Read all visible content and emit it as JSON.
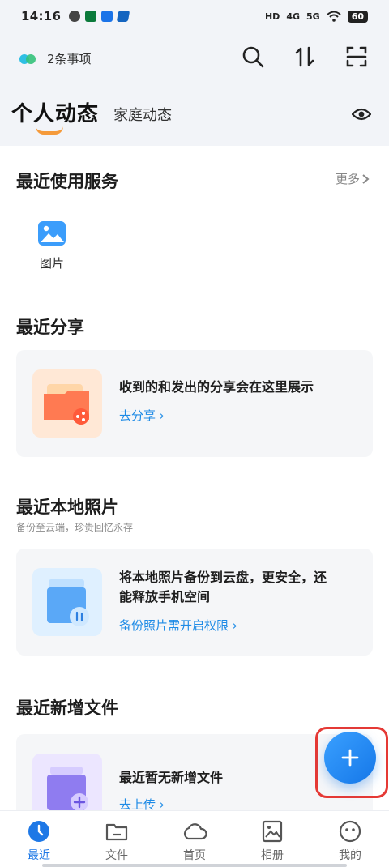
{
  "status_bar": {
    "time": "14:16",
    "battery": "60",
    "network": [
      "HD",
      "4G",
      "5G"
    ]
  },
  "top": {
    "todo_count_label": "2条事项",
    "icons": [
      "search-icon",
      "sort-icon",
      "scan-icon"
    ]
  },
  "tabs": {
    "personal": "个人动态",
    "family": "家庭动态"
  },
  "recent_services": {
    "title": "最近使用服务",
    "more": "更多",
    "items": [
      {
        "label": "图片",
        "icon": "image-icon"
      }
    ]
  },
  "recent_share": {
    "title": "最近分享",
    "card_text": "收到的和发出的分享会在这里展示",
    "link": "去分享 ›"
  },
  "recent_local_photos": {
    "title": "最近本地照片",
    "subtitle": "备份至云端，珍贵回忆永存",
    "card_line1": "将本地照片备份到云盘，更安全，还",
    "card_line2": "能释放手机空间",
    "link": "备份照片需开启权限 ›"
  },
  "recent_new_files": {
    "title": "最近新增文件",
    "card_text": "最近暂无新增文件",
    "link": "去上传 ›"
  },
  "fab": {
    "icon": "plus-icon"
  },
  "bottom_nav": [
    {
      "label": "最近",
      "active": true
    },
    {
      "label": "文件",
      "active": false
    },
    {
      "label": "首页",
      "active": false
    },
    {
      "label": "相册",
      "active": false
    },
    {
      "label": "我的",
      "active": false
    }
  ],
  "colors": {
    "accent": "#1e78e6",
    "tab_underline": "#f59a3a",
    "highlight": "#e53935"
  }
}
